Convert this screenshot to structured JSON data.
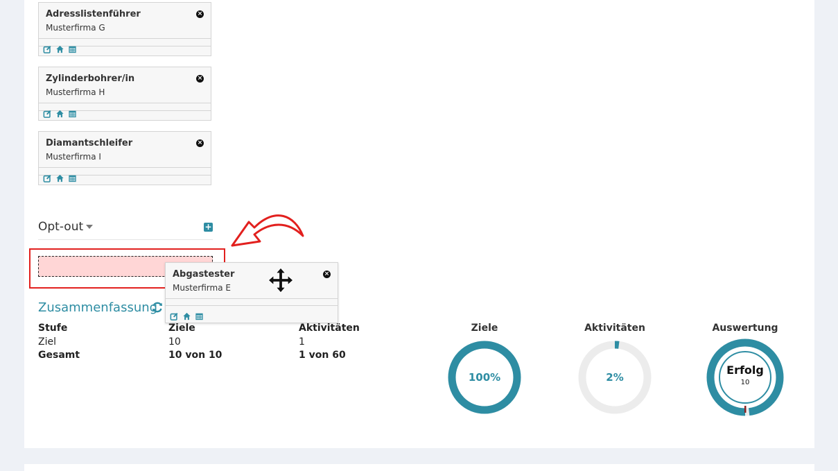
{
  "cards": [
    {
      "title": "Adresslistenführer",
      "company": "Musterfirma G"
    },
    {
      "title": "Zylinderbohrer/in",
      "company": "Musterfirma H"
    },
    {
      "title": "Diamantschleifer",
      "company": "Musterfirma I"
    }
  ],
  "optout": {
    "title": "Opt-out",
    "add_label": "+"
  },
  "dragged_card": {
    "title": "Abgastester",
    "company": "Musterfirma E"
  },
  "close_glyph": "×",
  "summary": {
    "title": "Zusammenfassung",
    "headers": [
      "Stufe",
      "Ziele",
      "Aktivitäten"
    ],
    "rows": [
      {
        "stufe": "Ziel",
        "ziele": "10",
        "aktivitaeten": "1"
      },
      {
        "stufe": "Gesamt",
        "ziele": "10 von 10",
        "aktivitaeten": "1 von 60"
      }
    ]
  },
  "gauges": [
    {
      "label": "Ziele",
      "value_text": "100%",
      "fraction": 1.0
    },
    {
      "label": "Aktivitäten",
      "value_text": "2%",
      "fraction": 0.02
    },
    {
      "label": "Auswertung",
      "result": "Erfolg",
      "result_value": "10",
      "fraction": 0.98
    }
  ],
  "colors": {
    "accent": "#2e8da3",
    "track": "#ececec",
    "dropzone_border": "#e2201e",
    "dropzone_fill": "#ffd6d6",
    "arrow": "#e2201e"
  }
}
